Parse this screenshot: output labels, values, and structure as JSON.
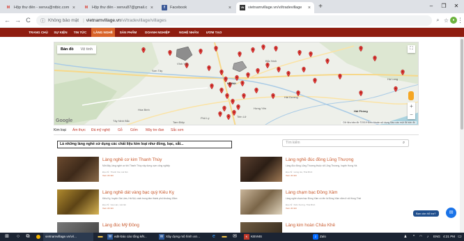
{
  "browser": {
    "tabs": [
      {
        "title": "Hộp thư đến - xenvu@ntbic.com",
        "favicon": "gmail-icon",
        "active": false
      },
      {
        "title": "Hộp thư đến - xenvu87@gmail.c",
        "favicon": "gmail-icon",
        "active": false
      },
      {
        "title": "Facebook",
        "favicon": "facebook-icon",
        "active": false
      },
      {
        "title": "vietnamvillage.vn/vi/tradevillage",
        "favicon": "vnl-icon",
        "active": true
      }
    ],
    "new_tab": "+",
    "window_controls": {
      "minimize": "–",
      "maximize": "❐",
      "close": "✕"
    },
    "nav": {
      "back": "←",
      "forward": "→",
      "reload": "C"
    },
    "address": {
      "security_label": "Không bảo mật",
      "host": "vietnamvillage.vn",
      "path": "/vi/tradevillage/villages"
    },
    "toolbar_icons": [
      "zoom-icon",
      "star-icon",
      "extension-icon",
      "menu-icon"
    ]
  },
  "site": {
    "nav": [
      "TRANG CHỦ",
      "SỰ KIỆN",
      "TIN TỨC",
      "LÀNG NGHỀ",
      "SẢN PHẨM",
      "DOANH NGHIỆP",
      "NGHỆ NHÂN",
      "ƯƠM TẠO"
    ],
    "active_nav": "LÀNG NGHỀ",
    "map": {
      "type_buttons": [
        "Bản đồ",
        "Vệ tinh"
      ],
      "active_type": "Bản đồ",
      "places": [
        "Sơn Tây",
        "Hà Nội",
        "Bắc Ninh",
        "Hải Dương",
        "Tiên Lữ",
        "Hưng Yên",
        "Phủ Lý",
        "Hòa Bình",
        "Vĩnh Yên",
        "Tây Ninh Bắc",
        "Hạ Long",
        "Hải Phòng",
        "Tam Điệp"
      ],
      "logo": "Google",
      "footer": "Dữ liệu bản đồ ©2019   Điều khoản sử dụng   Báo cáo một lỗi bản đồ",
      "zoom_in": "+",
      "zoom_out": "−",
      "fullscreen": "⛶"
    },
    "category_tabs": [
      "Kim loại",
      "Ẩm thực",
      "Đá mỹ nghệ",
      "Gỗ",
      "Gốm",
      "Mây tre đan",
      "Sắc sơn"
    ],
    "active_category": "Kim loại",
    "filter_text": "Là những làng nghề sử dụng các chất liệu kim loại như đồng, bạc, sắt...",
    "search_placeholder": "Tìm kiếm",
    "items_left": [
      {
        "title": "Làng nghề cơ kim Thanh Thùy",
        "desc": "Mới đây, làng nghề cơ khí Thanh Thùy xây dựng cụm công nghiệp",
        "meta": "Địa chỉ : Thanh Oai, Hà Nội",
        "link": "Xem chi tiết"
      },
      {
        "title": "Làng nghề dát vàng bạc quỳ Kiêu Kỵ",
        "desc": "Kiêu Kỵ, huyện Gia Lâm, Hà Nội, cách trung tâm thành phố khoảng 15km",
        "meta": "Địa chỉ : Gia Lâm, Hà Nội",
        "link": "Xem chi tiết"
      },
      {
        "title": "Làng đúc Mỹ Đồng",
        "desc": "",
        "meta": "",
        "link": ""
      }
    ],
    "items_right": [
      {
        "title": "Làng nghề đúc đồng Lũng Thượng",
        "desc": "Làng đúc đồng Lũng Thượng thuộc xã Lũng Thượng, huyện Hưng Hà",
        "meta": "Địa chỉ : Hưng Hà, Thái Bình",
        "link": "Xem chi tiết"
      },
      {
        "title": "Làng chạm bạc Đồng Xâm",
        "desc": "Làng nghề chạm bạc Đồng Xâm có tên là Đồng Xâm nằm ở xã Hồng Thái",
        "meta": "Địa chỉ : Kiến Xương, Thái Bình",
        "link": "Xem chi tiết"
      },
      {
        "title": "Làng kim hoàn Châu Khê",
        "desc": "",
        "meta": "",
        "link": ""
      }
    ],
    "chat_badge": "Bạn cần hỗ trợ?"
  },
  "taskbar": {
    "items": [
      "vietnamvillage.vn/vi/...",
      "edit-báo cáo tổng kết...",
      "Xây dựng mô hình ươ...",
      "KBVMS",
      "Zalo"
    ],
    "tray": {
      "lang": "ENG",
      "time": "4:21 PM"
    }
  },
  "colors": {
    "brand": "#8f1d10",
    "nav_active": "#d9642a",
    "link": "#c8592c",
    "taskbar": "#1b2433"
  }
}
